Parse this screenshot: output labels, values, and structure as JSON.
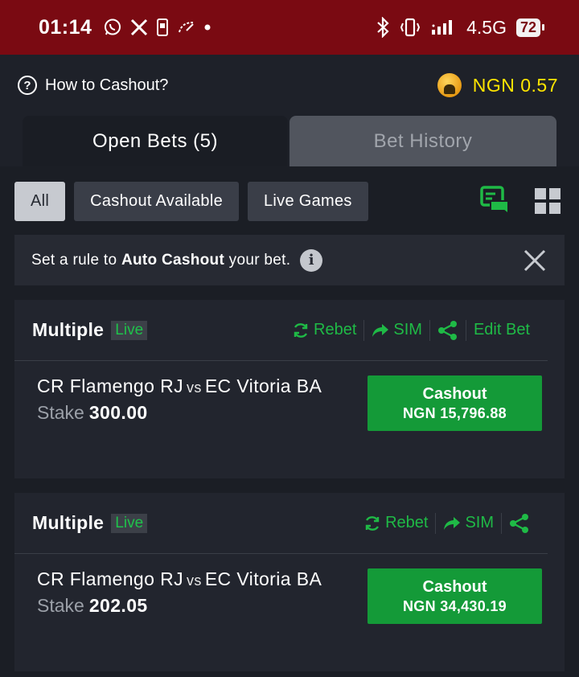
{
  "status_bar": {
    "time": "01:14",
    "network": "4.5G",
    "battery": "72"
  },
  "header": {
    "help_label": "How to Cashout?",
    "balance": "NGN 0.57"
  },
  "tabs": [
    {
      "label": "Open Bets (5)",
      "active": true
    },
    {
      "label": "Bet History",
      "active": false
    }
  ],
  "filters": [
    {
      "label": "All",
      "active": true
    },
    {
      "label": "Cashout Available",
      "active": false
    },
    {
      "label": "Live Games",
      "active": false
    }
  ],
  "banner": {
    "prefix": "Set a rule to ",
    "bold": "Auto Cashout",
    "suffix": " your bet."
  },
  "colors": {
    "status_bar": "#7a0a12",
    "accent_green": "#149a38",
    "action_green": "#1fba46",
    "balance_yellow": "#ffe500"
  },
  "bets": [
    {
      "title": "Multiple",
      "live_label": "Live",
      "actions": {
        "rebet": "Rebet",
        "sim": "SIM",
        "edit": "Edit Bet"
      },
      "home": "CR Flamengo RJ",
      "vs": "vs",
      "away": "EC Vitoria BA",
      "stake_label": "Stake",
      "stake": "300.00",
      "cashout_label": "Cashout",
      "cashout_amount": "NGN 15,796.88"
    },
    {
      "title": "Multiple",
      "live_label": "Live",
      "actions": {
        "rebet": "Rebet",
        "sim": "SIM"
      },
      "home": "CR Flamengo RJ",
      "vs": "vs",
      "away": "EC Vitoria BA",
      "stake_label": "Stake",
      "stake": "202.05",
      "cashout_label": "Cashout",
      "cashout_amount": "NGN 34,430.19"
    }
  ]
}
